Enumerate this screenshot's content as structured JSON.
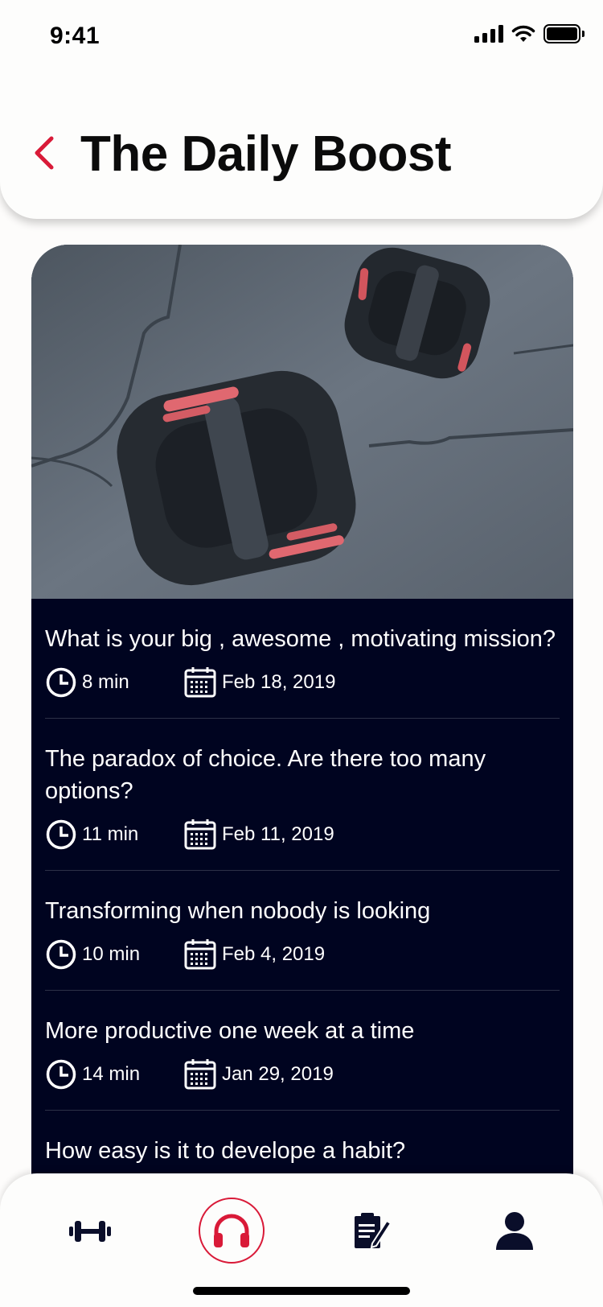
{
  "status_bar": {
    "time": "9:41"
  },
  "header": {
    "title": "The Daily Boost"
  },
  "colors": {
    "accent": "#d91a38",
    "list_background": "#000420",
    "text_on_dark": "#ffffff"
  },
  "episodes": [
    {
      "title": "What is your big , awesome , motivating mission?",
      "duration": "8 min",
      "date": "Feb 18, 2019"
    },
    {
      "title": "The paradox of choice. Are there too many options?",
      "duration": "11 min",
      "date": "Feb 11, 2019"
    },
    {
      "title": "Transforming when nobody is looking",
      "duration": "10 min",
      "date": "Feb 4, 2019"
    },
    {
      "title": "More productive one week at a time",
      "duration": "14 min",
      "date": "Jan 29, 2019"
    },
    {
      "title": "How easy is it to develope a habit?",
      "duration": "",
      "date": ""
    }
  ],
  "bottom_nav": {
    "items": [
      {
        "icon": "dumbbell-icon",
        "active": false
      },
      {
        "icon": "headphones-icon",
        "active": true
      },
      {
        "icon": "clipboard-edit-icon",
        "active": false
      },
      {
        "icon": "user-icon",
        "active": false
      }
    ]
  }
}
